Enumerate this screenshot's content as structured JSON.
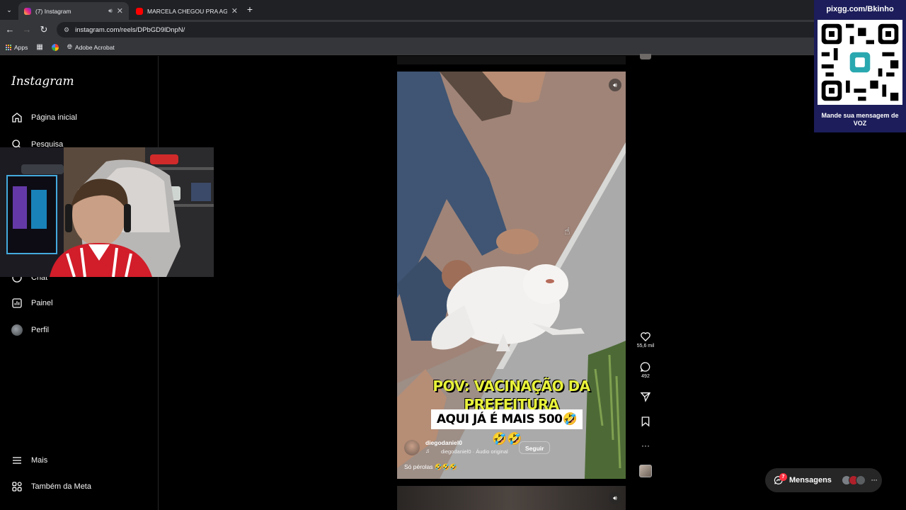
{
  "browser": {
    "tabs": [
      {
        "title": "(7) Instagram",
        "active": true
      },
      {
        "title": "MARCELA CHEGOU PRA AGILIZ",
        "active": false
      }
    ],
    "url": "instagram.com/reels/DPbGD9lDnpN/",
    "bookmarks": [
      "Apps",
      "Adobe Acrobat"
    ]
  },
  "sidebar": {
    "logo": "Instagram",
    "items": [
      {
        "label": "Página inicial",
        "icon": "home-icon"
      },
      {
        "label": "Pesquisa",
        "icon": "search-icon"
      },
      {
        "label": "Chat",
        "icon": "chat-icon"
      },
      {
        "label": "Painel",
        "icon": "dashboard-icon"
      },
      {
        "label": "Perfil",
        "icon": "avatar"
      },
      {
        "label": "Mais",
        "icon": "menu-icon"
      },
      {
        "label": "Também da Meta",
        "icon": "meta-icon"
      }
    ]
  },
  "reel": {
    "caption_line1": "POV: VACINAÇÃO DA",
    "caption_line2": "PREFEITURA",
    "caption_white": "AQUI JÁ É MAIS 500🤣🤣🤣",
    "username": "diegodaniel0",
    "audio": "diegodaniel0 · Áudio original",
    "follow_label": "Seguir",
    "description": "Só pérolas 🤣🤣🤣",
    "likes": "55,6 mil",
    "comments": "492"
  },
  "qr_widget": {
    "title": "pixgg.com/Bkinho",
    "caption": "Mande sua mensagem de VOZ"
  },
  "messages": {
    "label": "Mensagens",
    "badge": "7"
  }
}
